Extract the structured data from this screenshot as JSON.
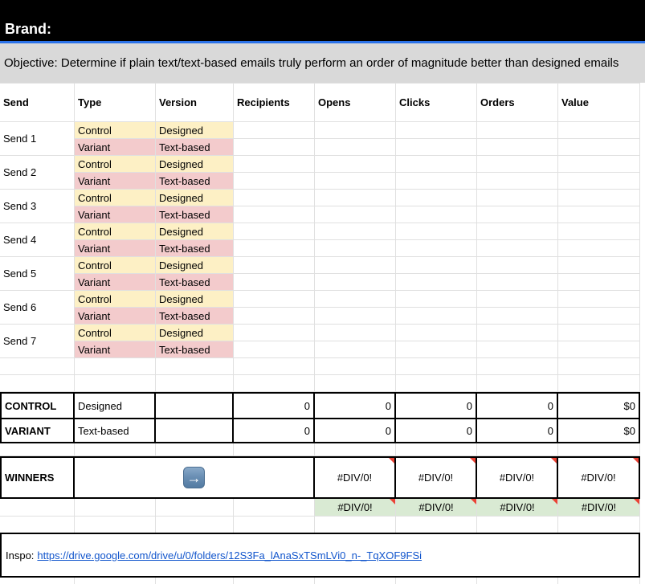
{
  "header": {
    "brand_label": "Brand:"
  },
  "objective": {
    "text": "Objective: Determine if plain text/text-based emails truly perform an order of magnitude better than designed emails"
  },
  "table": {
    "columns": [
      "Send",
      "Type",
      "Version",
      "Recipients",
      "Opens",
      "Clicks",
      "Orders",
      "Value"
    ],
    "sends": [
      {
        "name": "Send 1",
        "control": {
          "type": "Control",
          "version": "Designed"
        },
        "variant": {
          "type": "Variant",
          "version": "Text-based"
        }
      },
      {
        "name": "Send 2",
        "control": {
          "type": "Control",
          "version": "Designed"
        },
        "variant": {
          "type": "Variant",
          "version": "Text-based"
        }
      },
      {
        "name": "Send 3",
        "control": {
          "type": "Control",
          "version": "Designed"
        },
        "variant": {
          "type": "Variant",
          "version": "Text-based"
        }
      },
      {
        "name": "Send 4",
        "control": {
          "type": "Control",
          "version": "Designed"
        },
        "variant": {
          "type": "Variant",
          "version": "Text-based"
        }
      },
      {
        "name": "Send 5",
        "control": {
          "type": "Control",
          "version": "Designed"
        },
        "variant": {
          "type": "Variant",
          "version": "Text-based"
        }
      },
      {
        "name": "Send 6",
        "control": {
          "type": "Control",
          "version": "Designed"
        },
        "variant": {
          "type": "Variant",
          "version": "Text-based"
        }
      },
      {
        "name": "Send 7",
        "control": {
          "type": "Control",
          "version": "Designed"
        },
        "variant": {
          "type": "Variant",
          "version": "Text-based"
        }
      }
    ]
  },
  "summary": {
    "control": {
      "label": "CONTROL",
      "version": "Designed",
      "values": [
        "0",
        "0",
        "0",
        "0",
        "$0"
      ]
    },
    "variant": {
      "label": "VARIANT",
      "version": "Text-based",
      "values": [
        "0",
        "0",
        "0",
        "0",
        "$0"
      ]
    }
  },
  "winners": {
    "label": "WINNERS",
    "arrow_icon": "→",
    "errors": [
      "#DIV/0!",
      "#DIV/0!",
      "#DIV/0!",
      "#DIV/0!"
    ]
  },
  "ratio_row": {
    "errors": [
      "#DIV/0!",
      "#DIV/0!",
      "#DIV/0!",
      "#DIV/0!"
    ]
  },
  "inspo": {
    "label": "Inspo:",
    "link": "https://drive.google.com/drive/u/0/folders/12S3Fa_lAnaSxTSmLVi0_n-_TqXOF9FSi"
  },
  "colors": {
    "control_bg": "#fdf0c5",
    "variant_bg": "#f3cbcc",
    "winner_bg": "#d9ead3",
    "accent_blue": "#2b72e8",
    "link_blue": "#1155cc",
    "error_marker": "#ea4335",
    "objective_bg": "#d9d9d9"
  }
}
